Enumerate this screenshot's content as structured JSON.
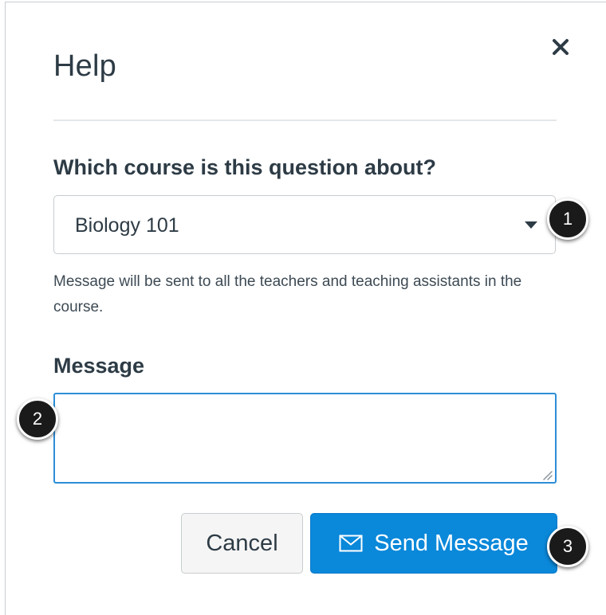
{
  "dialog": {
    "title": "Help",
    "close_icon": "close-icon"
  },
  "course_select": {
    "label": "Which course is this question about?",
    "selected_value": "Biology 101",
    "caret_icon": "caret-down-icon",
    "hint": "Message will be sent to all the teachers and teaching assistants in the course."
  },
  "message": {
    "label": "Message",
    "value": "",
    "placeholder": ""
  },
  "actions": {
    "cancel_label": "Cancel",
    "send_label": "Send Message",
    "send_icon": "mail-icon"
  },
  "callouts": [
    "1",
    "2",
    "3"
  ],
  "colors": {
    "primary": "#0a88da",
    "text": "#2d3b45",
    "focus_border": "#2c8ed8",
    "callout_bg": "#1a1a1a"
  }
}
